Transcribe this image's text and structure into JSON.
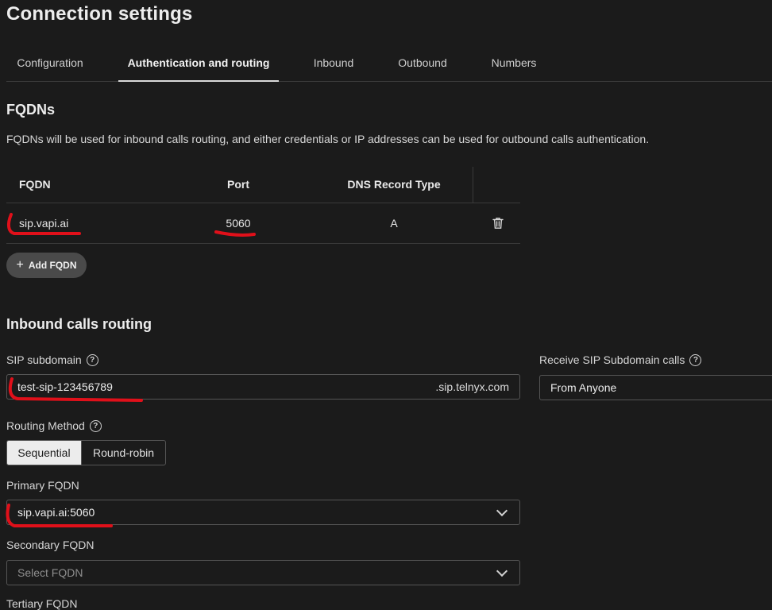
{
  "page": {
    "title": "Connection settings"
  },
  "tabs": [
    {
      "label": "Configuration"
    },
    {
      "label": "Authentication and routing",
      "active": true
    },
    {
      "label": "Inbound"
    },
    {
      "label": "Outbound"
    },
    {
      "label": "Numbers"
    }
  ],
  "fqdns": {
    "heading": "FQDNs",
    "description": "FQDNs will be used for inbound calls routing, and either credentials or IP addresses can be used for outbound calls authentication.",
    "columns": {
      "fqdn": "FQDN",
      "port": "Port",
      "dns": "DNS Record Type"
    },
    "rows": [
      {
        "fqdn": "sip.vapi.ai",
        "port": "5060",
        "dns": "A"
      }
    ],
    "add_label": "Add FQDN",
    "icons": {
      "delete": "trash-icon",
      "add": "plus-icon"
    }
  },
  "inbound": {
    "heading": "Inbound calls routing",
    "sip_subdomain": {
      "label": "SIP subdomain",
      "value": "test-sip-123456789",
      "suffix": ".sip.telnyx.com"
    },
    "receive_calls": {
      "label": "Receive SIP Subdomain calls",
      "value": "From Anyone"
    },
    "routing_method": {
      "label": "Routing Method",
      "options": [
        "Sequential",
        "Round-robin"
      ],
      "selected": "Sequential"
    },
    "primary": {
      "label": "Primary FQDN",
      "value": "sip.vapi.ai:5060"
    },
    "secondary": {
      "label": "Secondary FQDN",
      "placeholder": "Select FQDN"
    },
    "tertiary": {
      "label": "Tertiary FQDN"
    }
  },
  "colors": {
    "background": "#1b1b1b",
    "annotation": "#e0101a",
    "active_segment": "#ececec"
  }
}
